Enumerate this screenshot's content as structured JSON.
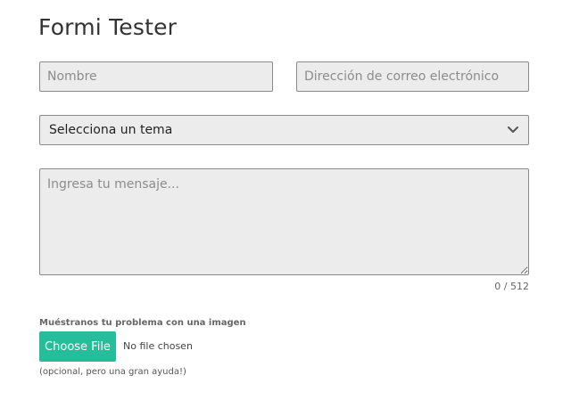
{
  "page": {
    "title": "Formi Tester"
  },
  "form": {
    "name_placeholder": "Nombre",
    "email_placeholder": "Dirección de correo electrónico",
    "topic_selected": "Selecciona un tema",
    "message_placeholder": "Ingresa tu mensaje...",
    "counter": "0 / 512",
    "upload_label": "Muéstranos tu problema con una imagen",
    "file_button_label": "Choose File",
    "file_status": "No file chosen",
    "helper_text": "(opcional, pero una gran ayuda!)"
  },
  "colors": {
    "accent": "#26bd9a",
    "field_bg": "#ececec",
    "field_border": "#8a8a8a"
  },
  "icons": {
    "select_arrow": "chevron-down-icon"
  }
}
